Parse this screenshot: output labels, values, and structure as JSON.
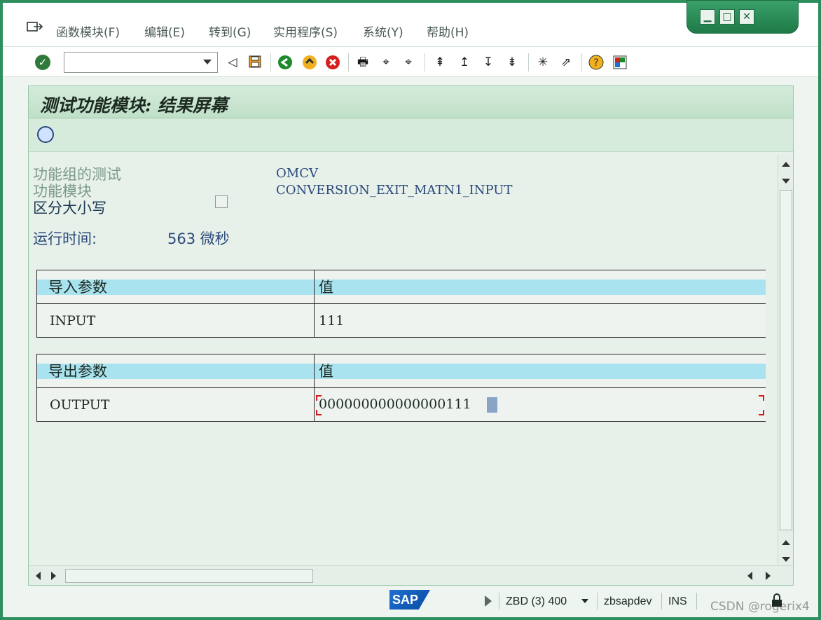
{
  "menubar": {
    "items": [
      {
        "label": "函数模块(F)"
      },
      {
        "label": "编辑(E)"
      },
      {
        "label": "转到(G)"
      },
      {
        "label": "实用程序(S)"
      },
      {
        "label": "系统(Y)"
      },
      {
        "label": "帮助(H)"
      }
    ]
  },
  "toolbar": {
    "command_field_value": ""
  },
  "screen": {
    "title": "测试功能模块: 结果屏幕",
    "function_group_label": "功能组的测试",
    "function_group_value": "OMCV",
    "function_module_label": "功能模块",
    "function_module_value": "CONVERSION_EXIT_MATN1_INPUT",
    "case_sensitive_label": "区分大小写",
    "runtime_label": "运行时间:",
    "runtime_value": "563 微秒"
  },
  "import_table": {
    "header_param": "导入参数",
    "header_value": "值",
    "rows": [
      {
        "param": "INPUT",
        "value": "111"
      }
    ]
  },
  "export_table": {
    "header_param": "导出参数",
    "header_value": "值",
    "rows": [
      {
        "param": "OUTPUT",
        "value": "000000000000000111"
      }
    ]
  },
  "statusbar": {
    "system": "ZBD (3) 400",
    "server": "zbsapdev",
    "mode": "INS",
    "watermark": "CSDN @rogerix4"
  },
  "colors": {
    "frame_green": "#2f8f5e",
    "header_cyan": "#a9e3f0",
    "label_gray_green": "#7a9a8a",
    "value_blue": "#2a4a7a"
  }
}
